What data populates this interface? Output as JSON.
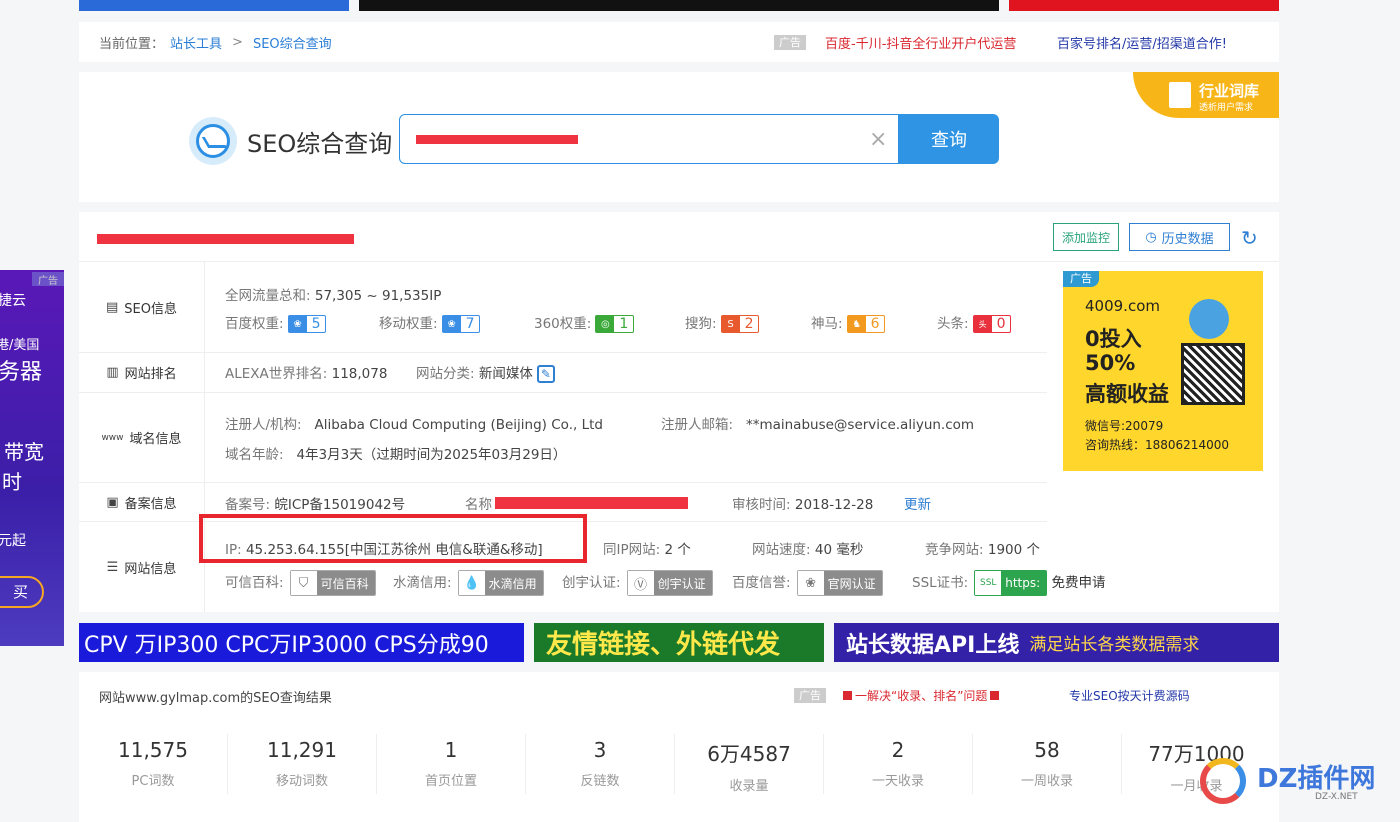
{
  "breadcrumb": {
    "label": "当前位置：",
    "link1": "站长工具",
    "sep": ">",
    "link2": "SEO综合查询",
    "ad_tag": "广告",
    "ad1": "百度-千川-抖音全行业开户代运营",
    "ad2": "百家号排名/运营/招渠道合作!"
  },
  "search": {
    "title": "SEO综合查询",
    "clear": "×",
    "button": "查询",
    "corner_title": "行业词库",
    "corner_sub": "透析用户需求"
  },
  "result": {
    "monitor_btn": "添加监控",
    "history_btn": "历史数据",
    "seo_label": "SEO信息",
    "traffic_label": "全网流量总和:",
    "traffic_value": "57,305 ~ 91,535IP",
    "weights": [
      {
        "label": "百度权重:",
        "value": "5",
        "color": "#3a8ee6"
      },
      {
        "label": "移动权重:",
        "value": "7",
        "color": "#3a8ee6"
      },
      {
        "label": "360权重:",
        "value": "1",
        "color": "#3aa93a"
      },
      {
        "label": "搜狗:",
        "value": "2",
        "color": "#e8592e"
      },
      {
        "label": "神马:",
        "value": "6",
        "color": "#f29a1f"
      },
      {
        "label": "头条:",
        "value": "0",
        "color": "#e8313c"
      }
    ],
    "rank_label": "网站排名",
    "alexa_label": "ALEXA世界排名:",
    "alexa_value": "118,078",
    "category_label": "网站分类:",
    "category_value": "新闻媒体",
    "domain_label": "域名信息",
    "registrant_label": "注册人/机构:",
    "registrant_value": "Alibaba Cloud Computing (Beijing) Co., Ltd",
    "email_label": "注册人邮箱:",
    "email_value": "**mainabuse@service.aliyun.com",
    "age_label": "域名年龄:",
    "age_value": "4年3月3天（过期时间为2025年03月29日）",
    "icp_label": "备案信息",
    "icp_no_label": "备案号:",
    "icp_no_value": "皖ICP备15019042号",
    "name_label": "名称",
    "audit_label": "审核时间:",
    "audit_value": "2018-12-28",
    "update_link": "更新",
    "site_label": "网站信息",
    "ip_label": "IP:",
    "ip_value": "45.253.64.155[中国江苏徐州 电信&联通&移动]",
    "same_ip_label": "同IP网站:",
    "same_ip_value": "2 个",
    "speed_label": "网站速度:",
    "speed_value": "40 毫秒",
    "compete_label": "竞争网站:",
    "compete_value": "1900 个",
    "certs": [
      {
        "label": "可信百科:",
        "badge": "可信百科"
      },
      {
        "label": "水滴信用:",
        "badge": "水滴信用"
      },
      {
        "label": "创宇认证:",
        "badge": "创宇认证"
      },
      {
        "label": "百度信誉:",
        "badge": "官网认证"
      }
    ],
    "ssl_label": "SSL证书:",
    "ssl_badge": "https:",
    "ssl_free": "免费申请"
  },
  "right_ad": {
    "tag": "广告",
    "domain": "4009.com",
    "line1": "0投入",
    "line2": "50%",
    "line3": "高额收益",
    "wx": "微信号:20079",
    "hotline": "咨询热线：18806214000"
  },
  "banners": [
    {
      "text": "CPV 万IP300 CPC万IP3000 CPS分成90",
      "bg": "#1a1adb",
      "color": "#ffffff"
    },
    {
      "text": "友情链接、外链代发",
      "bg": "#1b7a2a",
      "color": "#ffe94a"
    },
    {
      "text": "站长数据API上线",
      "sub": "满足站长各类数据需求",
      "bg": "#3322a8",
      "color": "#ffffff"
    }
  ],
  "stats": {
    "header": "网站www.gylmap.com的SEO查询结果",
    "ad_tag": "广告",
    "ad1": "一解决“收录、排名”问题",
    "ad2": "专业SEO按天计费源码",
    "items": [
      {
        "value": "11,575",
        "label": "PC词数"
      },
      {
        "value": "11,291",
        "label": "移动词数"
      },
      {
        "value": "1",
        "label": "首页位置"
      },
      {
        "value": "3",
        "label": "反链数"
      },
      {
        "value": "6万4587",
        "label": "收录量"
      },
      {
        "value": "2",
        "label": "一天收录"
      },
      {
        "value": "58",
        "label": "一周收录"
      },
      {
        "value": "77万1000",
        "label": "一月收录"
      }
    ]
  },
  "left_ad": {
    "tag": "广告",
    "l1": "捷云",
    "l2": "港/美国",
    "l3": "务器",
    "l4": "带宽",
    "l5": "时",
    "l6": "元起",
    "btn": "买"
  },
  "watermark": {
    "brand": "DZ插件网",
    "url": "DZ-X.NET"
  }
}
